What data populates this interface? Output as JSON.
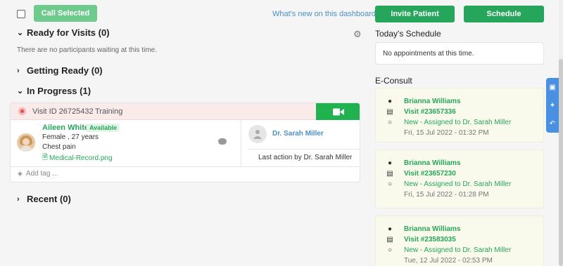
{
  "toolbar": {
    "call_selected": "Call Selected",
    "whats_new": "What's new on this dashboard?",
    "invite_patient": "Invite Patient",
    "schedule": "Schedule"
  },
  "sections": {
    "ready": {
      "title": "Ready for Visits (0)",
      "empty": "There are no participants waiting at this time."
    },
    "getting_ready": {
      "title": "Getting Ready (0)"
    },
    "in_progress": {
      "title": "In Progress (1)"
    },
    "recent": {
      "title": "Recent (0)"
    }
  },
  "visit": {
    "id": "Visit ID 26725432",
    "type": "Training",
    "patient_name": "Aileen White",
    "status": "Available",
    "demographics": "Female , 27 years",
    "complaint": "Chest pain",
    "attachment": "Medical-Record.png",
    "provider": "Dr. Sarah Miller",
    "last_action": "Last action by Dr. Sarah Miller",
    "add_tag_placeholder": "Add tag ..."
  },
  "schedule": {
    "title": "Today's Schedule",
    "empty": "No appointments at this time."
  },
  "econsult": {
    "title": "E-Consult",
    "items": [
      {
        "name": "Brianna Williams",
        "visit": "Visit #23657336",
        "status": "New - Assigned to Dr. Sarah Miller",
        "date": "Fri, 15 Jul 2022 - 01:32 PM"
      },
      {
        "name": "Brianna Williams",
        "visit": "Visit #23657230",
        "status": "New - Assigned to Dr. Sarah Miller",
        "date": "Fri, 15 Jul 2022 - 01:28 PM"
      },
      {
        "name": "Brianna Williams",
        "visit": "Visit #23583035",
        "status": "New - Assigned to Dr. Sarah Miller",
        "date": "Tue, 12 Jul 2022 - 02:53 PM"
      }
    ]
  },
  "colors": {
    "brand_green": "#26a65b",
    "video_green": "#1fb24f",
    "accent_blue": "#4a90c6"
  }
}
